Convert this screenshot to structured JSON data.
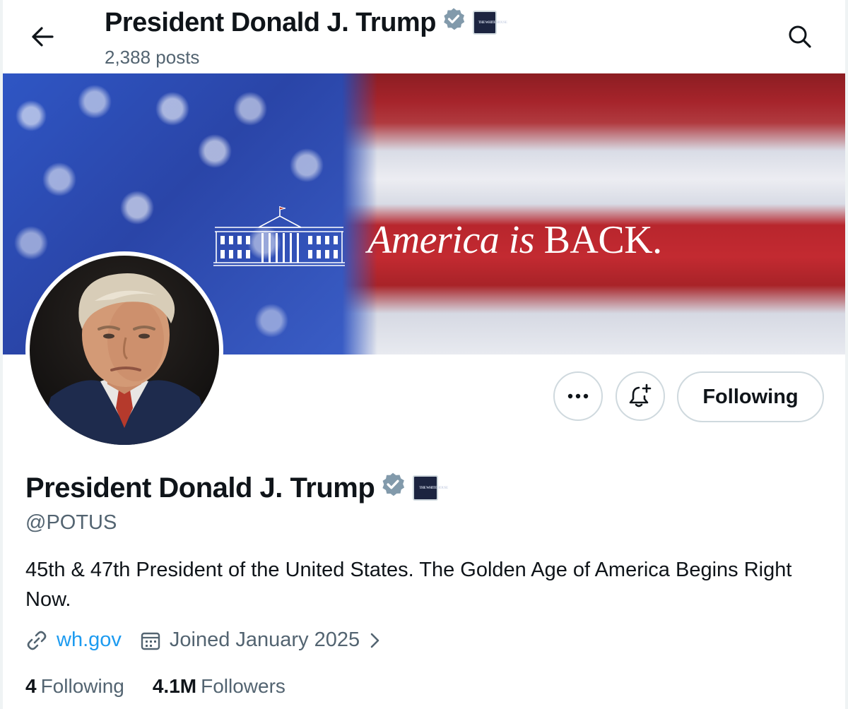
{
  "header": {
    "title": "President Donald J. Trump",
    "post_count": "2,388 posts"
  },
  "banner": {
    "tagline_italic": "America is",
    "tagline_upright": "BACK."
  },
  "profile": {
    "name": "President Donald J. Trump",
    "handle": "@POTUS",
    "bio": "45th & 47th President of the United States. The Golden Age of America Begins Right Now.",
    "website": "wh.gov",
    "joined": "Joined January 2025",
    "following_count": "4",
    "following_label": "Following",
    "followers_count": "4.1M",
    "followers_label": "Followers"
  },
  "actions": {
    "follow_state_label": "Following"
  },
  "badges": {
    "verified_color": "#829aab",
    "affiliation_text": "THE WHITE HOUSE"
  },
  "icons": {
    "back": "arrow-left-icon",
    "search": "search-icon",
    "more": "more-dots-icon",
    "notify": "bell-plus-icon",
    "link": "link-icon",
    "calendar": "calendar-icon",
    "chevron": "chevron-right-icon"
  },
  "colors": {
    "text_primary": "#0f1419",
    "text_secondary": "#536471",
    "link": "#1d9bf0",
    "border": "#cfd9de"
  }
}
